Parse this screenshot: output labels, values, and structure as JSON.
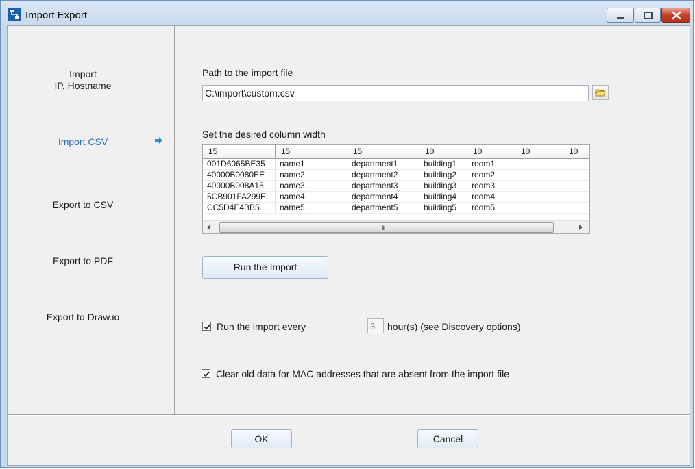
{
  "window": {
    "title": "Import Export",
    "icon": "app-network-icon",
    "controls": [
      "minimize-icon",
      "maximize-icon",
      "close-icon"
    ]
  },
  "sidebar": {
    "items": [
      {
        "label_line1": "Import",
        "label_line2": "IP, Hostname"
      },
      {
        "label": "Import CSV",
        "active": true
      },
      {
        "label": "Export to CSV"
      },
      {
        "label": "Export to PDF"
      },
      {
        "label": "Export to Draw.io"
      }
    ],
    "active_arrow_icon": "arrow-right-icon",
    "active_color": "#1f6fc4"
  },
  "import": {
    "path_label": "Path to the import file",
    "path_value": "C:\\import\\custom.csv",
    "browse_icon": "folder-icon",
    "column_width_label": "Set the desired column width",
    "columns": [
      "15",
      "15",
      "15",
      "10",
      "10",
      "10",
      "10"
    ],
    "rows": [
      [
        "001D6065BE35",
        "name1",
        "department1",
        "building1",
        "room1",
        "",
        ""
      ],
      [
        "40000B0080EE",
        "name2",
        "department2",
        "building2",
        "room2",
        "",
        ""
      ],
      [
        "40000B008A15",
        "name3",
        "department3",
        "building3",
        "room3",
        "",
        ""
      ],
      [
        "5CB901FA299E",
        "name4",
        "department4",
        "building4",
        "room4",
        "",
        ""
      ],
      [
        "CC5D4E4BB5...",
        "name5",
        "department5",
        "building5",
        "room5",
        "",
        ""
      ]
    ],
    "scroll_grip": "III",
    "run_button": "Run the Import",
    "schedule": {
      "checked": true,
      "label": "Run the import every",
      "hours_value": "3",
      "hours_suffix": "hour(s) (see Discovery options)"
    },
    "clear_old": {
      "checked": true,
      "label": "Clear old data for MAC addresses that are absent from the import file"
    }
  },
  "footer": {
    "ok": "OK",
    "cancel": "Cancel"
  }
}
